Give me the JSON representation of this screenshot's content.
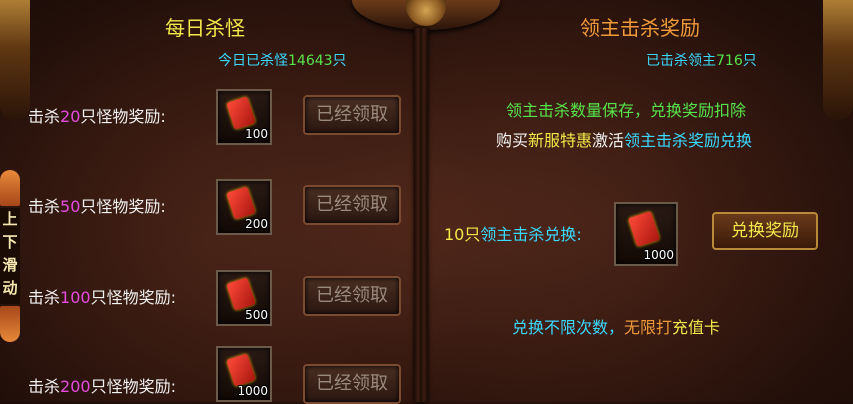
{
  "daily": {
    "title": "每日杀怪",
    "stat_prefix": "今日已杀怪",
    "stat_count": "14643",
    "stat_suffix": "只",
    "rows": [
      {
        "prefix": "击杀",
        "count": "20",
        "suffix": "只怪物奖励:",
        "item_qty": "100",
        "button": "已经领取"
      },
      {
        "prefix": "击杀",
        "count": "50",
        "suffix": "只怪物奖励:",
        "item_qty": "200",
        "button": "已经领取"
      },
      {
        "prefix": "击杀",
        "count": "100",
        "suffix": "只怪物奖励:",
        "item_qty": "500",
        "button": "已经领取"
      },
      {
        "prefix": "击杀",
        "count": "200",
        "suffix": "只怪物奖励:",
        "item_qty": "1000",
        "button": "已经领取"
      }
    ]
  },
  "boss": {
    "title": "领主击杀奖励",
    "stat_prefix": "已击杀领主",
    "stat_count": "716",
    "stat_suffix": "只",
    "info1": "领主击杀数量保存，兑换奖励扣除",
    "info2": {
      "a": "购买",
      "b": "新服特惠",
      "c": "激活",
      "d": "领主击杀奖励兑换"
    },
    "exchange": {
      "count": "10只",
      "label": "领主击杀兑换:",
      "item_qty": "1000",
      "button": "兑换奖励"
    },
    "info3": {
      "a": "兑换不限次数，",
      "b": "无限打",
      "c": "充值卡"
    }
  },
  "scroll_tab": {
    "chars": [
      "上",
      "下",
      "滑",
      "动"
    ]
  },
  "colors": {
    "title_yellow": "#f3e94a",
    "title_orange": "#f09a3a",
    "cyan": "#3ad9ff",
    "green": "#56e44b",
    "magenta": "#e64adf"
  }
}
